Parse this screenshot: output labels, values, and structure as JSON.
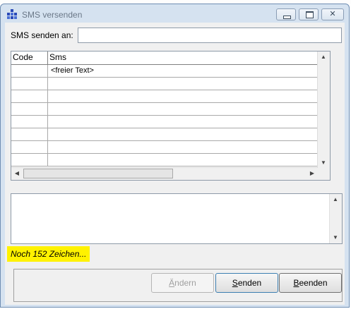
{
  "window": {
    "title": "SMS versenden",
    "icon": "app-grid-icon",
    "controls": [
      "minimize-icon",
      "maximize-icon",
      "close-icon"
    ]
  },
  "recipient": {
    "label": "SMS senden an:",
    "value": ""
  },
  "grid": {
    "columns": [
      "Code",
      "Sms"
    ],
    "rows": [
      {
        "code": "",
        "sms": "<freier Text>"
      },
      {
        "code": "",
        "sms": ""
      },
      {
        "code": "",
        "sms": ""
      },
      {
        "code": "",
        "sms": ""
      },
      {
        "code": "",
        "sms": ""
      },
      {
        "code": "",
        "sms": ""
      },
      {
        "code": "",
        "sms": ""
      },
      {
        "code": "",
        "sms": ""
      }
    ]
  },
  "message": {
    "value": ""
  },
  "counter": {
    "text": "Noch 152 Zeichen..."
  },
  "buttons": {
    "change": {
      "underline": "Ä",
      "rest": "ndern",
      "enabled": false
    },
    "send": {
      "underline": "S",
      "rest": "enden",
      "enabled": true
    },
    "quit": {
      "underline": "B",
      "rest": "eenden",
      "enabled": true
    }
  },
  "colors": {
    "highlight": "#fff200",
    "frame": "#d5e2f0"
  }
}
